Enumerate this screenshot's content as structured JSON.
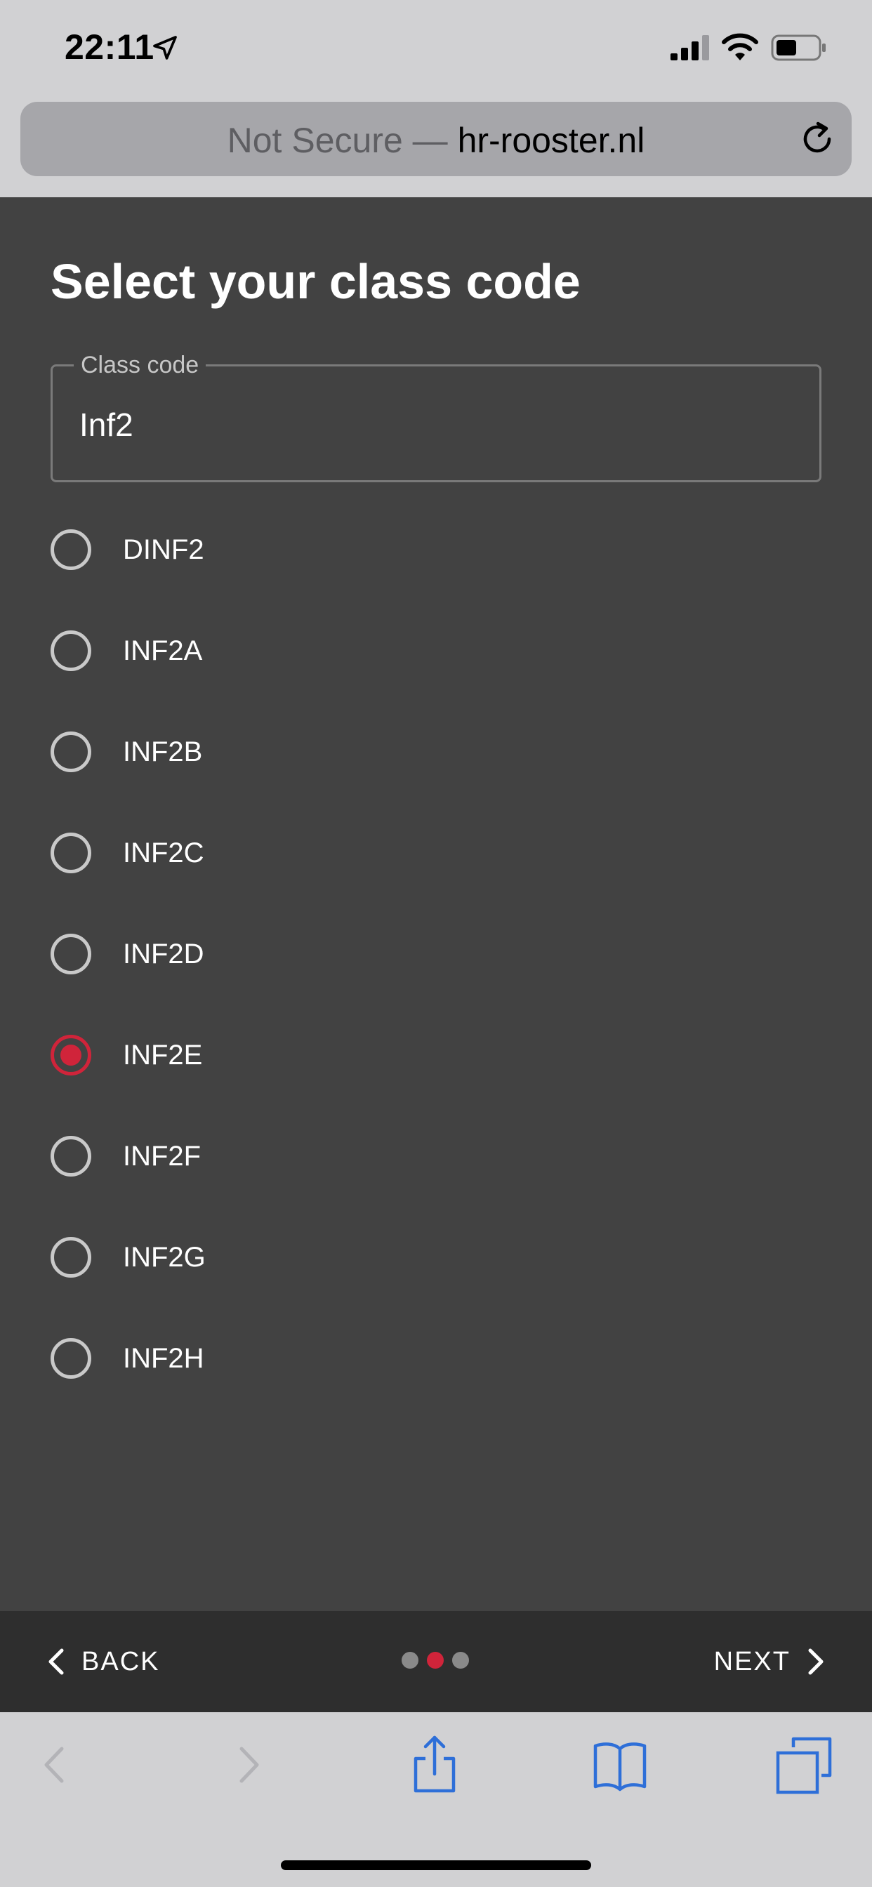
{
  "status_bar": {
    "time": "22:11",
    "icons": [
      "location-arrow-icon",
      "cellular-signal-icon",
      "wifi-icon",
      "battery-icon"
    ]
  },
  "url_bar": {
    "security_text": "Not Secure —",
    "domain": "hr-rooster.nl"
  },
  "page": {
    "title": "Select your class code",
    "field": {
      "label": "Class code",
      "value": "Inf2"
    },
    "options": [
      {
        "label": "DINF2",
        "selected": false
      },
      {
        "label": "INF2A",
        "selected": false
      },
      {
        "label": "INF2B",
        "selected": false
      },
      {
        "label": "INF2C",
        "selected": false
      },
      {
        "label": "INF2D",
        "selected": false
      },
      {
        "label": "INF2E",
        "selected": true
      },
      {
        "label": "INF2F",
        "selected": false
      },
      {
        "label": "INF2G",
        "selected": false
      },
      {
        "label": "INF2H",
        "selected": false
      }
    ],
    "accent_color": "#d0243a"
  },
  "wizard_nav": {
    "back_label": "BACK",
    "next_label": "NEXT",
    "step_count": 3,
    "current_step": 2
  },
  "toolbar": {
    "icons": [
      "back-arrow-icon",
      "forward-arrow-icon",
      "share-icon",
      "bookmarks-icon",
      "tabs-icon"
    ]
  }
}
